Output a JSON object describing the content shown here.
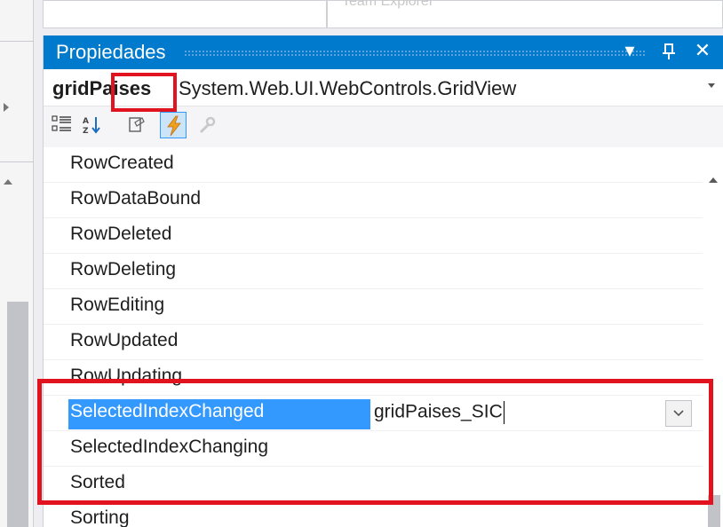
{
  "colors": {
    "titlebar": "#007acc",
    "selection": "#3399ff",
    "highlight_box": "#e0131f"
  },
  "top_tabs": [
    {
      "label": ""
    },
    {
      "label": "Team Explorer"
    }
  ],
  "panel": {
    "title": "Propiedades",
    "buttons": [
      {
        "icon": "dropdown-arrow-icon",
        "glyph": "▾"
      },
      {
        "icon": "pin-icon",
        "glyph": "⊥"
      },
      {
        "icon": "close-icon",
        "glyph": "✕"
      }
    ],
    "object": {
      "name": "gridPaises",
      "type": "System.Web.UI.WebControls.GridView"
    },
    "toolbar": [
      {
        "icon": "categorized-icon",
        "active": false
      },
      {
        "icon": "alphabetical-icon",
        "active": false
      },
      {
        "icon": "properties-icon",
        "active": false
      },
      {
        "icon": "events-lightning-icon",
        "active": true
      },
      {
        "icon": "property-pages-wrench-icon",
        "active": false
      }
    ],
    "events": [
      {
        "name": "RowCreated",
        "value": ""
      },
      {
        "name": "RowDataBound",
        "value": ""
      },
      {
        "name": "RowDeleted",
        "value": ""
      },
      {
        "name": "RowDeleting",
        "value": ""
      },
      {
        "name": "RowEditing",
        "value": ""
      },
      {
        "name": "RowUpdated",
        "value": ""
      },
      {
        "name": "RowUpdating",
        "value": ""
      },
      {
        "name": "SelectedIndexChanged",
        "value": "gridPaises_SIC",
        "selected": true
      },
      {
        "name": "SelectedIndexChanging",
        "value": ""
      },
      {
        "name": "Sorted",
        "value": ""
      },
      {
        "name": "Sorting",
        "value": ""
      }
    ]
  }
}
